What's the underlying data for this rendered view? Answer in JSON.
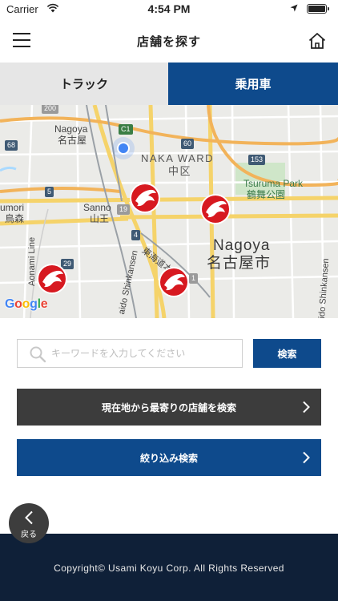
{
  "status_bar": {
    "carrier": "Carrier",
    "time": "4:54 PM"
  },
  "header": {
    "title": "店舗を探す",
    "menu_icon": "hamburger-menu-icon",
    "home_icon": "home-icon"
  },
  "tabs": [
    {
      "label": "トラック",
      "selected": false
    },
    {
      "label": "乗用車",
      "selected": true
    }
  ],
  "map": {
    "labels": {
      "nagoya_en": "Nagoya",
      "nagoya_jp": "名古屋",
      "naka_ward": "NAKA WARD",
      "naka_ku": "中区",
      "tsuruma_park": "Tsuruma Park",
      "tsuruma_koen": "鶴舞公園",
      "umori": "umori",
      "umori_jp": "鳥森",
      "sanno": "Sanno",
      "sanno_jp": "山王",
      "nagoya_city_en": "Nagoya",
      "nagoya_city_jp": "名古屋市",
      "tokaido": "東海道本線",
      "aonami_line": "Aonami Line",
      "shinkansen": "aido Shinkansen",
      "ido_shinkansen": "ido Shinkansen"
    },
    "route_shields": {
      "r200": "200",
      "c1": "C1",
      "r60": "60",
      "r68": "68",
      "r153": "153",
      "r5": "5",
      "r4": "4",
      "r29": "29",
      "r19": "19",
      "r1": "1"
    },
    "google_logo": "Google",
    "store_marker_count": 4
  },
  "search": {
    "placeholder": "キーワードを入力してください",
    "value": "",
    "button_label": "検索"
  },
  "actions": {
    "nearest_label": "現在地から最寄りの店舗を検索",
    "filter_label": "絞り込み検索"
  },
  "back_button": {
    "label": "戻る"
  },
  "footer": {
    "copyright": "Copyright© Usami Koyu Corp. All Rights Reserved"
  },
  "colors": {
    "brand_blue": "#0e4a8c",
    "dark_button": "#3c3c3c",
    "footer_bg": "#0f2038",
    "marker_red": "#d71920"
  }
}
